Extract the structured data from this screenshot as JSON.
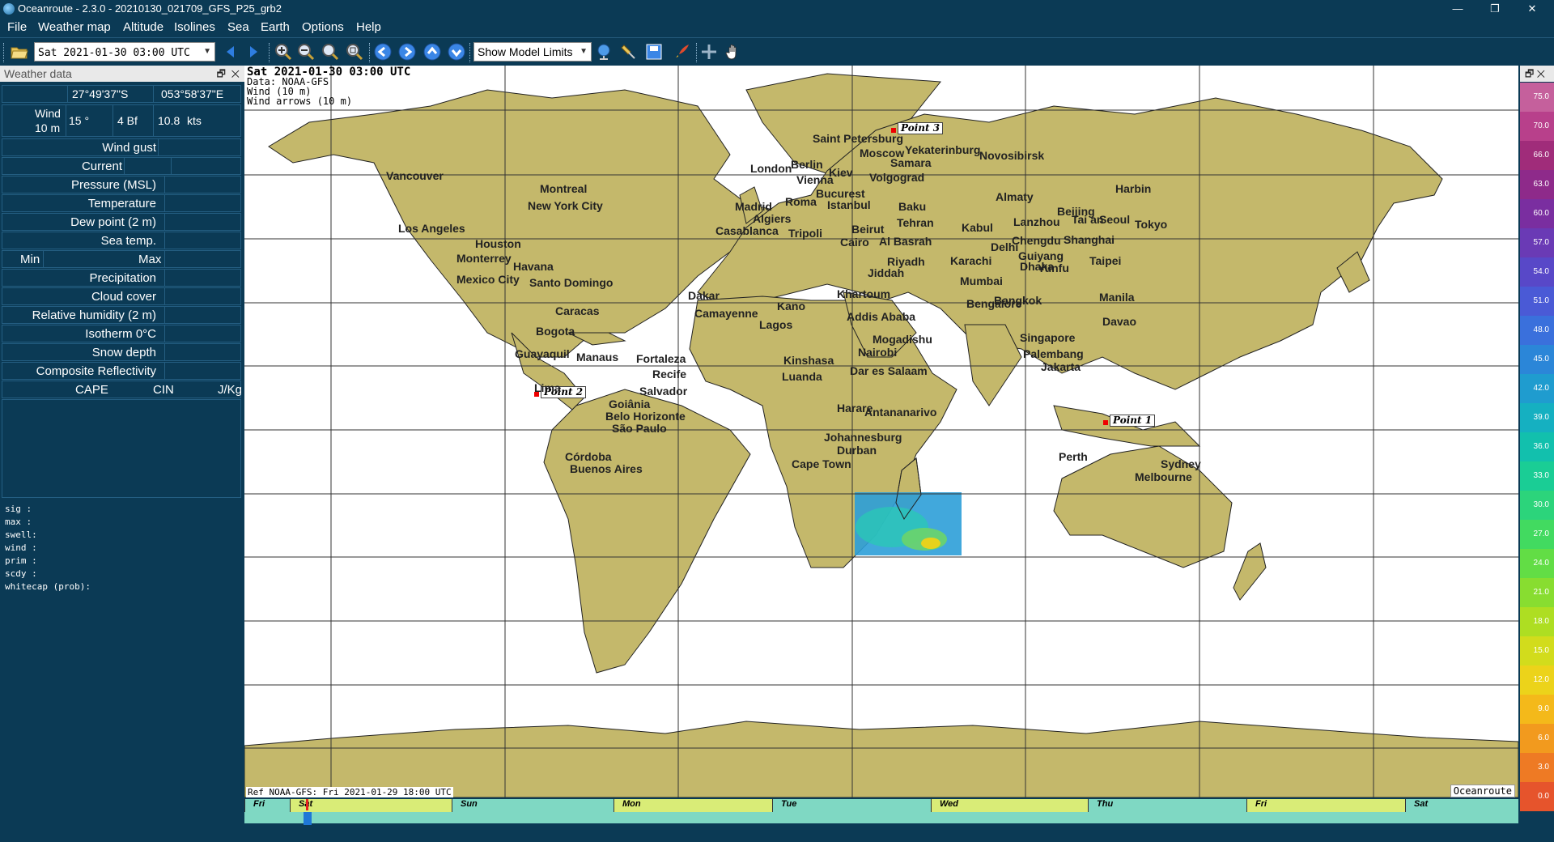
{
  "window": {
    "title": "Oceanroute - 2.3.0 - 20210130_021709_GFS_P25_grb2",
    "minimize": "—",
    "restore": "❐",
    "close": "✕"
  },
  "menu": [
    "File",
    "Weather map",
    "Altitude",
    "Isolines",
    "Sea",
    "Earth",
    "Options",
    "Help"
  ],
  "toolbar": {
    "date_select": "Sat 2021-01-30 03:00 UTC",
    "model_select": "Show Model Limits",
    "icons": [
      "open-icon",
      "prev-icon",
      "next-icon",
      "zoom-in-icon",
      "zoom-out-icon",
      "zoom-all-icon",
      "zoom-sel-icon",
      "pan-left-icon",
      "pan-right-icon",
      "pan-up-icon",
      "pan-down-icon",
      "globe-icon",
      "pin-icon",
      "save-icon",
      "rocket-icon",
      "crosshair-icon",
      "hand-icon"
    ]
  },
  "weather_panel": {
    "title": "Weather data",
    "lat": "27°49'37\"S",
    "lon": "053°58'37\"E",
    "wind_label_1": "Wind",
    "wind_label_2": "10 m",
    "wind_dir": "15 °",
    "wind_bf": "4 Bf",
    "wind_kts": "10.8",
    "wind_unit": "kts",
    "rows": [
      "Wind gust",
      "Current",
      "Pressure (MSL)",
      "Temperature",
      "Dew point (2 m)",
      "Sea temp."
    ],
    "min": "Min",
    "max": "Max",
    "rows2": [
      "Precipitation",
      "Cloud cover",
      "Relative humidity (2 m)",
      "Isotherm 0°C",
      "Snow depth",
      "Composite Reflectivity"
    ],
    "cape": "CAPE",
    "cin": "CIN",
    "jkg": "J/Kg"
  },
  "waves": [
    "sig  :",
    "max  :",
    "swell:",
    "wind :",
    "prim :",
    "scdy :",
    "whitecap (prob):"
  ],
  "map": {
    "info_date": "Sat 2021-01-30 03:00 UTC",
    "info_data": "Data: NOAA-GFS",
    "info_wind": "Wind (10 m)",
    "info_arrows": "Wind arrows (10 m)",
    "ref": "Ref NOAA-GFS: Fri 2021-01-29 18:00 UTC",
    "brand": "Oceanroute",
    "points": [
      "Point 1",
      "Point 2",
      "Point 3"
    ],
    "cities": [
      "Vancouver",
      "Montreal",
      "New York City",
      "Los Angeles",
      "Houston",
      "Monterrey",
      "Havana",
      "Santo Domingo",
      "Mexico City",
      "Caracas",
      "Bogota",
      "Guayaquil",
      "Manaus",
      "Fortaleza",
      "Recife",
      "Salvador",
      "Lima",
      "Goiânia",
      "Belo Horizonte",
      "São Paulo",
      "Córdoba",
      "Buenos Aires",
      "London",
      "Berlin",
      "Saint Petersburg",
      "Moscow",
      "Kiev",
      "Vienna",
      "Bucurest",
      "Roma",
      "Madrid",
      "Algiers",
      "Istanbul",
      "Casablanca",
      "Tripoli",
      "Cairo",
      "Beirut",
      "Al Basrah",
      "Baku",
      "Tehran",
      "Samara",
      "Volgograd",
      "Yekaterinburg",
      "Novosibirsk",
      "Almaty",
      "Kabul",
      "Karachi",
      "Delhi",
      "Mumbai",
      "Bengalore",
      "Dhaka",
      "Riyadh",
      "Jiddah",
      "Khartoum",
      "Addis Ababa",
      "Mogadishu",
      "Nairobi",
      "Dar es Salaam",
      "Dakar",
      "Kano",
      "Lagos",
      "Camayenne",
      "Kinshasa",
      "Luanda",
      "Harare",
      "Antananarivo",
      "Johannesburg",
      "Durban",
      "Cape Town",
      "Harbin",
      "Beijing",
      "Seoul",
      "Tokyo",
      "Lanzhou",
      "Chengdu",
      "Shanghai",
      "Taipei",
      "Guiyang",
      "Yunfu",
      "Manila",
      "Davao",
      "Bangkok",
      "Singapore",
      "Palembang",
      "Jakarta",
      "Perth",
      "Sydney",
      "Melbourne",
      "Tai an"
    ]
  },
  "timeline": {
    "days": [
      "Fri",
      "Sat",
      "Sun",
      "Mon",
      "Tue",
      "Wed",
      "Thu",
      "Fri",
      "Sat"
    ]
  },
  "scale": {
    "values": [
      "75.0",
      "70.0",
      "66.0",
      "63.0",
      "60.0",
      "57.0",
      "54.0",
      "51.0",
      "48.0",
      "45.0",
      "42.0",
      "39.0",
      "36.0",
      "33.0",
      "30.0",
      "27.0",
      "24.0",
      "21.0",
      "18.0",
      "15.0",
      "12.0",
      "9.0",
      "6.0",
      "3.0",
      "0.0"
    ],
    "colors": [
      "#c5609c",
      "#b8408b",
      "#a02c7a",
      "#8e2a8a",
      "#7a2ea0",
      "#6a3ab5",
      "#5848c8",
      "#4a5ad6",
      "#3a70dc",
      "#2b86d8",
      "#1f9ccf",
      "#15b0c1",
      "#12c0ad",
      "#1acd95",
      "#2cd47b",
      "#42da60",
      "#62dd45",
      "#88dd30",
      "#aede22",
      "#d2dc1c",
      "#ecd31a",
      "#f4b91a",
      "#f29a1e",
      "#ee7a24",
      "#e6542c"
    ]
  }
}
